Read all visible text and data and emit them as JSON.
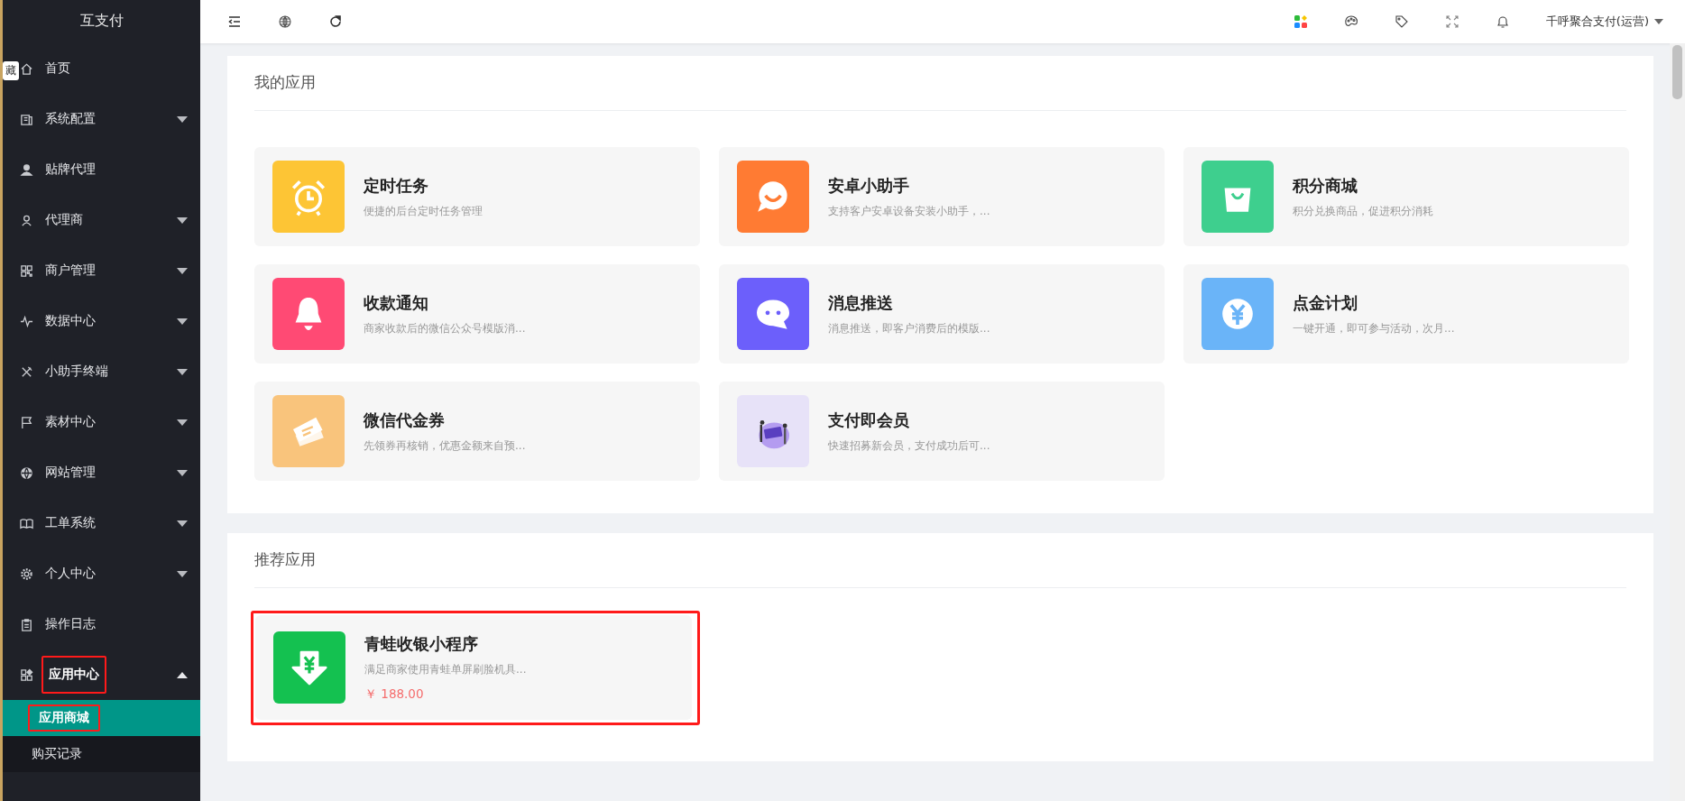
{
  "sidebar": {
    "logo": "互支付",
    "tooltip": "藏",
    "items": [
      {
        "label": "首页",
        "expandable": false,
        "expanded": false,
        "highlighted": false
      },
      {
        "label": "系统配置",
        "expandable": true,
        "expanded": false,
        "highlighted": false
      },
      {
        "label": "贴牌代理",
        "expandable": false,
        "expanded": false,
        "highlighted": false
      },
      {
        "label": "代理商",
        "expandable": true,
        "expanded": false,
        "highlighted": false
      },
      {
        "label": "商户管理",
        "expandable": true,
        "expanded": false,
        "highlighted": false
      },
      {
        "label": "数据中心",
        "expandable": true,
        "expanded": false,
        "highlighted": false
      },
      {
        "label": "小助手终端",
        "expandable": true,
        "expanded": false,
        "highlighted": false
      },
      {
        "label": "素材中心",
        "expandable": true,
        "expanded": false,
        "highlighted": false
      },
      {
        "label": "网站管理",
        "expandable": true,
        "expanded": false,
        "highlighted": false
      },
      {
        "label": "工单系统",
        "expandable": true,
        "expanded": false,
        "highlighted": false
      },
      {
        "label": "个人中心",
        "expandable": true,
        "expanded": false,
        "highlighted": false
      },
      {
        "label": "操作日志",
        "expandable": false,
        "expanded": false,
        "highlighted": false
      },
      {
        "label": "应用中心",
        "expandable": true,
        "expanded": true,
        "highlighted": true,
        "children": [
          {
            "label": "应用商城",
            "selected": true,
            "highlighted": true
          },
          {
            "label": "购买记录",
            "selected": false,
            "highlighted": false
          }
        ]
      }
    ]
  },
  "topbar": {
    "user": "千呼聚合支付(运营)"
  },
  "my_apps": {
    "title": "我的应用",
    "apps": [
      {
        "title": "定时任务",
        "description": "便捷的后台定时任务管理"
      },
      {
        "title": "安卓小助手",
        "description": "支持客户安卓设备安装小助手，..."
      },
      {
        "title": "积分商城",
        "description": "积分兑换商品，促进积分消耗"
      },
      {
        "title": "收款通知",
        "description": "商家收款后的微信公众号模版消..."
      },
      {
        "title": "消息推送",
        "description": "消息推送，即客户消费后的模版..."
      },
      {
        "title": "点金计划",
        "description": "一键开通，即可参与活动，次月..."
      },
      {
        "title": "微信代金券",
        "description": "先领券再核销，优惠金额来自预..."
      },
      {
        "title": "支付即会员",
        "description": "快速招募新会员，支付成功后可..."
      }
    ]
  },
  "recommended": {
    "title": "推荐应用",
    "apps": [
      {
        "title": "青蛙收银小程序",
        "description": "满足商家使用青蛙单屏刷脸机具...",
        "price": "￥ 188.00",
        "highlighted": true
      }
    ]
  }
}
